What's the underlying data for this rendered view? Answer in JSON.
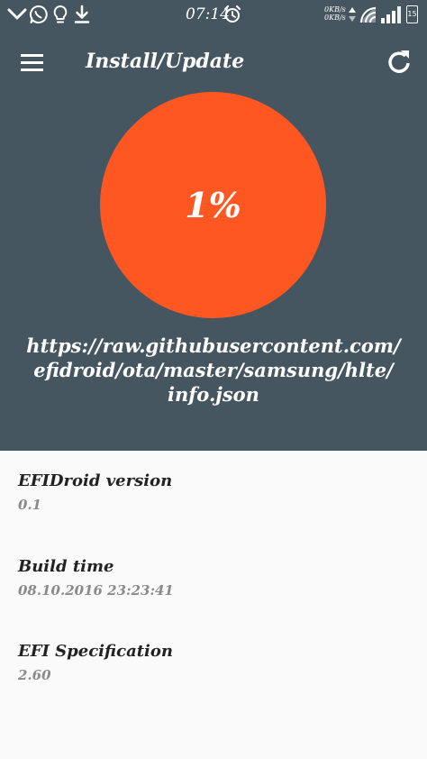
{
  "status_bar": {
    "time": "07:14",
    "net_up": "0KB/s",
    "net_down": "0KB/s",
    "battery": "15",
    "icons": [
      "chevron-down-icon",
      "whatsapp-icon",
      "lightbulb-icon",
      "download-icon",
      "alarm-icon",
      "wifi-icon",
      "signal-icon",
      "battery-icon"
    ]
  },
  "header": {
    "title": "Install/Update",
    "menu_icon": "menu-icon",
    "refresh_icon": "refresh-icon"
  },
  "progress": {
    "value": 1,
    "label": "1%",
    "color": "#FF5722"
  },
  "source": {
    "url": "https://raw.githubusercontent.com/\nefidroid/ota/master/samsung/hlte/\ninfo.json"
  },
  "info": {
    "items": [
      {
        "label": "EFIDroid version",
        "value": "0.1"
      },
      {
        "label": "Build time",
        "value": "08.10.2016 23:23:41"
      },
      {
        "label": "EFI Specification",
        "value": "2.60"
      }
    ]
  },
  "colors": {
    "primary": "#465660",
    "accent": "#FF5722",
    "background": "#FAFAFA"
  }
}
